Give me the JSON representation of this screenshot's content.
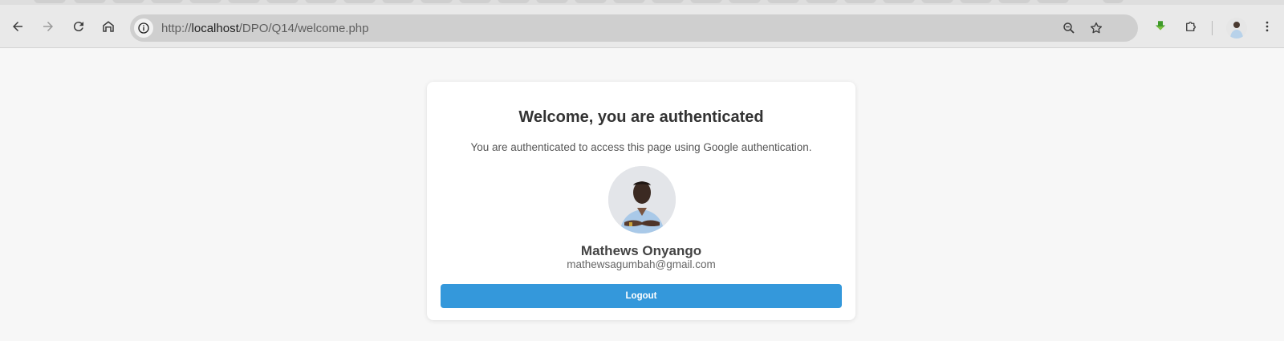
{
  "browser": {
    "url_prefix": "http://",
    "url_host": "localhost",
    "url_path": "/DPO/Q14/welcome.php"
  },
  "page": {
    "title": "Welcome, you are authenticated",
    "subtitle": "You are authenticated to access this page using Google authentication.",
    "user_name": "Mathews Onyango",
    "user_email": "mathewsagumbah@gmail.com",
    "logout_label": "Logout"
  },
  "colors": {
    "button": "#3498db",
    "background": "#f7f7f7",
    "card": "#ffffff"
  },
  "icons": [
    "back-icon",
    "forward-icon",
    "reload-icon",
    "home-icon",
    "site-info-icon",
    "zoom-icon",
    "bookmark-star-icon",
    "extension-download-icon",
    "extensions-puzzle-icon",
    "profile-avatar",
    "menu-kebab-icon"
  ]
}
